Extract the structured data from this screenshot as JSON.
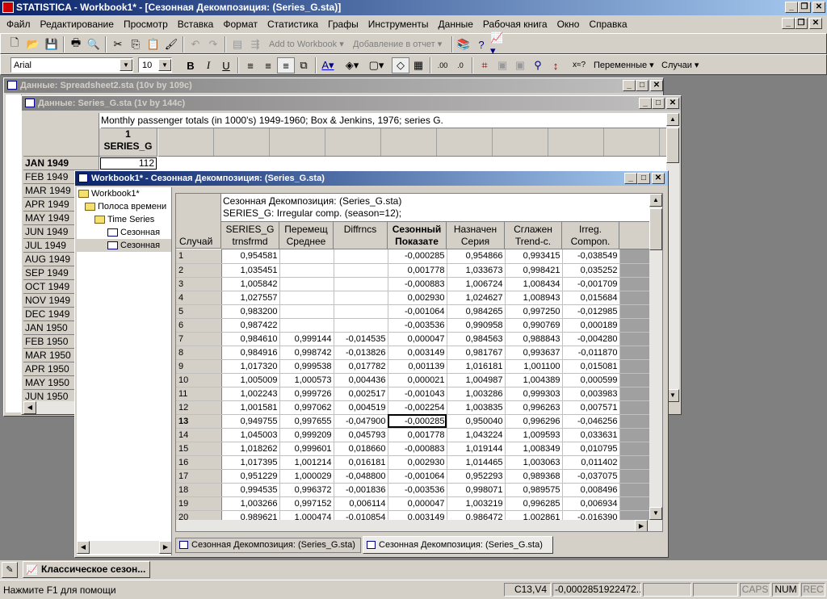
{
  "app": {
    "title": "STATISTICA - Workbook1* - [Сезонная Декомпозиция: (Series_G.sta)]"
  },
  "menu": [
    "Файл",
    "Редактирование",
    "Просмотр",
    "Вставка",
    "Формат",
    "Статистика",
    "Графы",
    "Инструменты",
    "Данные",
    "Рабочая книга",
    "Окно",
    "Справка"
  ],
  "toolbar": {
    "add_to_workbook": "Add to Workbook",
    "add_to_report": "Добавление в отчет"
  },
  "format_bar": {
    "font": "Arial",
    "size": "10",
    "bold": "B",
    "italic": "I",
    "underline": "U",
    "vars_label": "Переменные",
    "cases_label": "Случаи",
    "sort_label": "x≈?"
  },
  "win_spreadsheet2": {
    "title": "Данные: Spreadsheet2.sta (10v by 109c)"
  },
  "win_series": {
    "title": "Данные: Series_G.sta (1v by 144c)",
    "header_note": "Monthly passenger totals (in 1000's) 1949-1960; Box & Jenkins, 1976; series G.",
    "col_num": "1",
    "col_name": "SERIES_G",
    "first_row_label": "JAN 1949",
    "first_row_value": "112",
    "row_labels": [
      "FEB 1949",
      "MAR 1949",
      "APR 1949",
      "MAY 1949",
      "JUN 1949",
      "JUL 1949",
      "AUG 1949",
      "SEP 1949",
      "OCT 1949",
      "NOV 1949",
      "DEC 1949",
      "JAN 1950",
      "FEB 1950",
      "MAR 1950",
      "APR 1950",
      "MAY 1950",
      "JUN 1950"
    ]
  },
  "workbook": {
    "title": "Workbook1* - Сезонная Декомпозиция: (Series_G.sta)",
    "tree": [
      "Workbook1*",
      "Полоса времени",
      "Time Series",
      "Сезонная",
      "Сезонная"
    ],
    "table_title1": "Сезонная Декомпозиция: (Series_G.sta)",
    "table_title2": "SERIES_G: Irregular comp. (season=12);",
    "row_header_label": "Случай",
    "columns": [
      {
        "l1": "SERIES_G",
        "l2": "trnsfrmd"
      },
      {
        "l1": "Перемещ",
        "l2": "Среднее"
      },
      {
        "l1": "Diffrncs",
        "l2": ""
      },
      {
        "l1": "Сезонный",
        "l2": "Показате"
      },
      {
        "l1": "Назначен",
        "l2": "Серия"
      },
      {
        "l1": "Сглажен",
        "l2": "Trend-c."
      },
      {
        "l1": "Irreg.",
        "l2": "Compon."
      }
    ],
    "rows": [
      {
        "id": "1",
        "v": [
          "0,954581",
          "",
          "",
          "-0,000285",
          "0,954866",
          "0,993415",
          "-0,038549"
        ]
      },
      {
        "id": "2",
        "v": [
          "1,035451",
          "",
          "",
          "0,001778",
          "1,033673",
          "0,998421",
          "0,035252"
        ]
      },
      {
        "id": "3",
        "v": [
          "1,005842",
          "",
          "",
          "-0,000883",
          "1,006724",
          "1,008434",
          "-0,001709"
        ]
      },
      {
        "id": "4",
        "v": [
          "1,027557",
          "",
          "",
          "0,002930",
          "1,024627",
          "1,008943",
          "0,015684"
        ]
      },
      {
        "id": "5",
        "v": [
          "0,983200",
          "",
          "",
          "-0,001064",
          "0,984265",
          "0,997250",
          "-0,012985"
        ]
      },
      {
        "id": "6",
        "v": [
          "0,987422",
          "",
          "",
          "-0,003536",
          "0,990958",
          "0,990769",
          "0,000189"
        ]
      },
      {
        "id": "7",
        "v": [
          "0,984610",
          "0,999144",
          "-0,014535",
          "0,000047",
          "0,984563",
          "0,988843",
          "-0,004280"
        ]
      },
      {
        "id": "8",
        "v": [
          "0,984916",
          "0,998742",
          "-0,013826",
          "0,003149",
          "0,981767",
          "0,993637",
          "-0,011870"
        ]
      },
      {
        "id": "9",
        "v": [
          "1,017320",
          "0,999538",
          "0,017782",
          "0,001139",
          "1,016181",
          "1,001100",
          "0,015081"
        ]
      },
      {
        "id": "10",
        "v": [
          "1,005009",
          "1,000573",
          "0,004436",
          "0,000021",
          "1,004987",
          "1,004389",
          "0,000599"
        ]
      },
      {
        "id": "11",
        "v": [
          "1,002243",
          "0,999726",
          "0,002517",
          "-0,001043",
          "1,003286",
          "0,999303",
          "0,003983"
        ]
      },
      {
        "id": "12",
        "v": [
          "1,001581",
          "0,997062",
          "0,004519",
          "-0,002254",
          "1,003835",
          "0,996263",
          "0,007571"
        ]
      },
      {
        "id": "13",
        "v": [
          "0,949755",
          "0,997655",
          "-0,047900",
          "-0,000285",
          "0,950040",
          "0,996296",
          "-0,046256"
        ]
      },
      {
        "id": "14",
        "v": [
          "1,045003",
          "0,999209",
          "0,045793",
          "0,001778",
          "1,043224",
          "1,009593",
          "0,033631"
        ]
      },
      {
        "id": "15",
        "v": [
          "1,018262",
          "0,999601",
          "0,018660",
          "-0,000883",
          "1,019144",
          "1,008349",
          "0,010795"
        ]
      },
      {
        "id": "16",
        "v": [
          "1,017395",
          "1,001214",
          "0,016181",
          "0,002930",
          "1,014465",
          "1,003063",
          "0,011402"
        ]
      },
      {
        "id": "17",
        "v": [
          "0,951229",
          "1,000029",
          "-0,048800",
          "-0,001064",
          "0,952293",
          "0,989368",
          "-0,037075"
        ]
      },
      {
        "id": "18",
        "v": [
          "0,994535",
          "0,996372",
          "-0,001836",
          "-0,003536",
          "0,998071",
          "0,989575",
          "0,008496"
        ]
      },
      {
        "id": "19",
        "v": [
          "1,003266",
          "0,997152",
          "0,006114",
          "0,000047",
          "1,003219",
          "0,996285",
          "0,006934"
        ]
      },
      {
        "id": "20",
        "v": [
          "0,989621",
          "1,000474",
          "-0,010854",
          "0,003149",
          "0,986472",
          "1,002861",
          "-0,016390"
        ]
      }
    ],
    "tabs": [
      "Сезонная Декомпозиция: (Series_G.sta)",
      "Сезонная Декомпозиция: (Series_G.sta)"
    ]
  },
  "taskbar": {
    "item": "Классическое сезон..."
  },
  "status": {
    "help": "Нажмите F1 для помощи",
    "cell": "C13,V4",
    "value": "-0,0002851922472...",
    "caps": "CAPS",
    "num": "NUM",
    "rec": "REC"
  }
}
